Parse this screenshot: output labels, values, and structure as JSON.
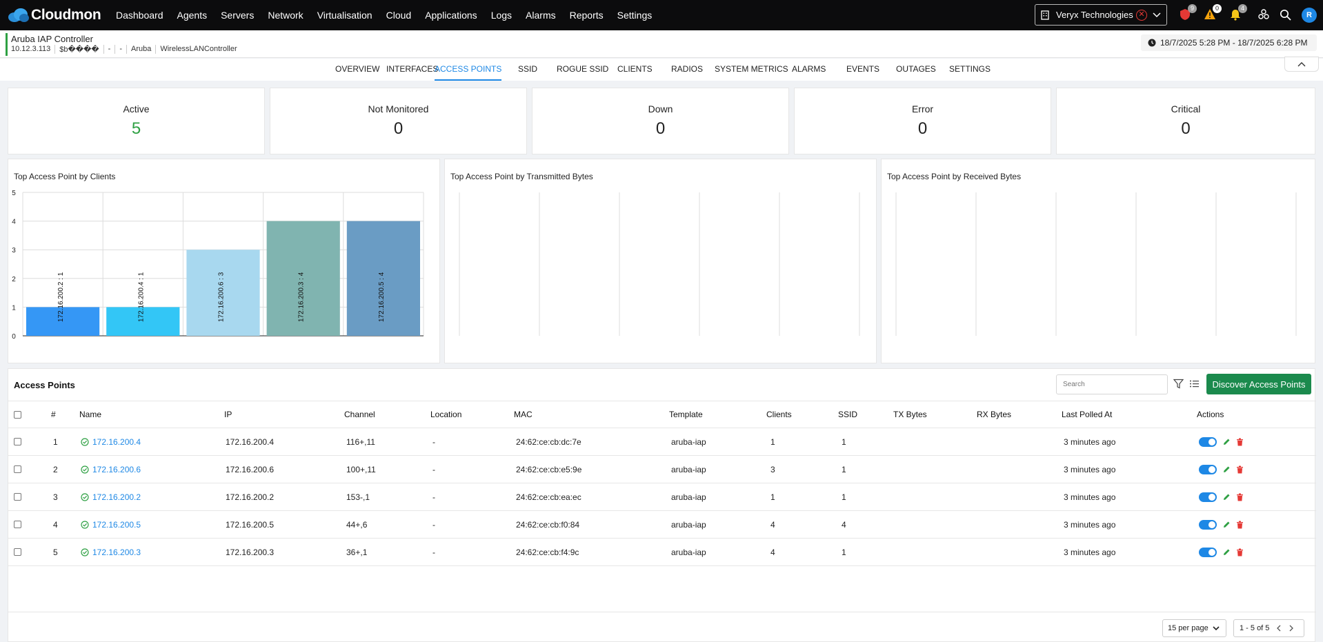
{
  "brand": {
    "name": "Cloudmon"
  },
  "nav": {
    "menu": [
      "Dashboard",
      "Agents",
      "Servers",
      "Network",
      "Virtualisation",
      "Cloud",
      "Applications",
      "Logs",
      "Alarms",
      "Reports",
      "Settings"
    ],
    "org": "Veryx Technologies",
    "badges": {
      "security": "9",
      "warnings": "0",
      "notifications": "4"
    },
    "avatar": "R"
  },
  "device": {
    "title": "Aruba IAP Controller",
    "meta": [
      "10.12.3.113",
      "$b����",
      "-",
      "-",
      "Aruba",
      "WirelessLANController"
    ],
    "time_range": "18/7/2025 5:28 PM - 18/7/2025 6:28 PM"
  },
  "tabs": [
    "OVERVIEW",
    "INTERFACES",
    "ACCESS POINTS",
    "SSID",
    "ROGUE SSID",
    "CLIENTS",
    "RADIOS",
    "SYSTEM METRICS",
    "ALARMS",
    "EVENTS",
    "OUTAGES",
    "SETTINGS"
  ],
  "active_tab": "ACCESS POINTS",
  "stats": [
    {
      "label": "Active",
      "value": "5"
    },
    {
      "label": "Not Monitored",
      "value": "0"
    },
    {
      "label": "Down",
      "value": "0"
    },
    {
      "label": "Error",
      "value": "0"
    },
    {
      "label": "Critical",
      "value": "0"
    }
  ],
  "colors": {
    "active_green": "#2ea043",
    "accent_blue": "#1e88e5",
    "discover_green": "#1b8a4d",
    "delete_red": "#e53935"
  },
  "chart_data": [
    {
      "type": "bar",
      "title": "Top Access Point by Clients",
      "categories": [
        "172.16.200.2",
        "172.16.200.4",
        "172.16.200.6",
        "172.16.200.3",
        "172.16.200.5"
      ],
      "values": [
        1,
        1,
        3,
        4,
        4
      ],
      "data_labels": [
        "172.16.200.2 : 1",
        "172.16.200.4 : 1",
        "172.16.200.6 : 3",
        "172.16.200.3 : 4",
        "172.16.200.5 : 4"
      ],
      "colors": [
        "#3597f5",
        "#33c6f6",
        "#a8d8ef",
        "#80b4b0",
        "#6a9cc4"
      ],
      "yticks": [
        "0",
        "1",
        "2",
        "3",
        "4",
        "5"
      ],
      "ylim": [
        0,
        5
      ],
      "grid": true
    },
    {
      "type": "bar",
      "title": "Top Access Point by Transmitted Bytes",
      "categories": [],
      "values": [],
      "grid": true
    },
    {
      "type": "bar",
      "title": "Top Access Point by Received Bytes",
      "categories": [],
      "values": [],
      "grid": true
    }
  ],
  "access_points": {
    "title": "Access Points",
    "search_placeholder": "Search",
    "discover_label": "Discover Access Points",
    "columns": [
      "#",
      "Name",
      "IP",
      "Channel",
      "Location",
      "MAC",
      "Template",
      "Clients",
      "SSID",
      "TX Bytes",
      "RX Bytes",
      "Last Polled At",
      "Actions"
    ],
    "rows": [
      {
        "num": "1",
        "name": "172.16.200.4",
        "ip": "172.16.200.4",
        "channel": "116+,11",
        "location": "-",
        "mac": "24:62:ce:cb:dc:7e",
        "template": "aruba-iap",
        "clients": "1",
        "ssid": "1",
        "tx": "",
        "rx": "",
        "polled": "3 minutes ago"
      },
      {
        "num": "2",
        "name": "172.16.200.6",
        "ip": "172.16.200.6",
        "channel": "100+,11",
        "location": "-",
        "mac": "24:62:ce:cb:e5:9e",
        "template": "aruba-iap",
        "clients": "3",
        "ssid": "1",
        "tx": "",
        "rx": "",
        "polled": "3 minutes ago"
      },
      {
        "num": "3",
        "name": "172.16.200.2",
        "ip": "172.16.200.2",
        "channel": "153-,1",
        "location": "-",
        "mac": "24:62:ce:cb:ea:ec",
        "template": "aruba-iap",
        "clients": "1",
        "ssid": "1",
        "tx": "",
        "rx": "",
        "polled": "3 minutes ago"
      },
      {
        "num": "4",
        "name": "172.16.200.5",
        "ip": "172.16.200.5",
        "channel": "44+,6",
        "location": "-",
        "mac": "24:62:ce:cb:f0:84",
        "template": "aruba-iap",
        "clients": "4",
        "ssid": "4",
        "tx": "",
        "rx": "",
        "polled": "3 minutes ago"
      },
      {
        "num": "5",
        "name": "172.16.200.3",
        "ip": "172.16.200.3",
        "channel": "36+,1",
        "location": "-",
        "mac": "24:62:ce:cb:f4:9c",
        "template": "aruba-iap",
        "clients": "4",
        "ssid": "1",
        "tx": "",
        "rx": "",
        "polled": "3 minutes ago"
      }
    ],
    "per_page": "15 per page",
    "pagination": "1 - 5 of 5"
  }
}
